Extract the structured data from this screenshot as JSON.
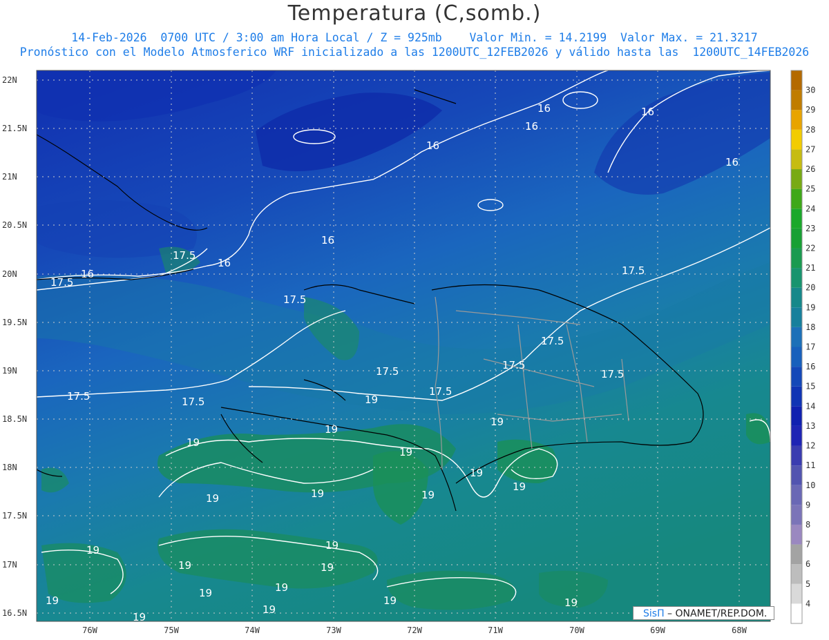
{
  "header": {
    "title": "Temperatura (C,somb.)",
    "subtitle_line1": "14-Feb-2026  0700 UTC / 3:00 am Hora Local / Z = 925mb    Valor Min. = 14.2199  Valor Max. = 21.3217",
    "subtitle_line2": "Pronóstico con el Modelo Atmosferico WRF inicializado a las 1200UTC_12FEB2026 y válido hasta las  1200UTC_14FEB2026"
  },
  "axes": {
    "lat_labels": [
      "22N",
      "21.5N",
      "21N",
      "20.5N",
      "20N",
      "19.5N",
      "19N",
      "18.5N",
      "18N",
      "17.5N",
      "17N",
      "16.5N"
    ],
    "lon_labels": [
      "76W",
      "75W",
      "74W",
      "73W",
      "72W",
      "71W",
      "70W",
      "69W",
      "68W"
    ]
  },
  "colorbar": {
    "labels": [
      "4",
      "5",
      "6",
      "7",
      "8",
      "9",
      "10",
      "11",
      "12",
      "13",
      "14",
      "15",
      "16",
      "17",
      "18",
      "19",
      "20",
      "21",
      "22",
      "23",
      "24",
      "25",
      "26",
      "27",
      "28",
      "29",
      "30"
    ],
    "colors": [
      "#ffffff",
      "#d9d9d9",
      "#bdbdbd",
      "#a3a3a3",
      "#9a88c0",
      "#7b74b8",
      "#6a68b5",
      "#5254b0",
      "#3a3cb0",
      "#1e24b4",
      "#1020b0",
      "#1034b4",
      "#1448b8",
      "#1860bc",
      "#1c70b8",
      "#17809c",
      "#16888a",
      "#18946e",
      "#1a9a50",
      "#18a034",
      "#1aa82a",
      "#3ea818",
      "#78aa14",
      "#c6bc12",
      "#f2cc00",
      "#e8a400",
      "#c07c00",
      "#b46a00"
    ]
  },
  "contour_labels": [
    "16",
    "17.5",
    "19"
  ],
  "credit": {
    "brand": "SisΠ",
    "text": " – ONAMET/REP.DOM."
  }
}
